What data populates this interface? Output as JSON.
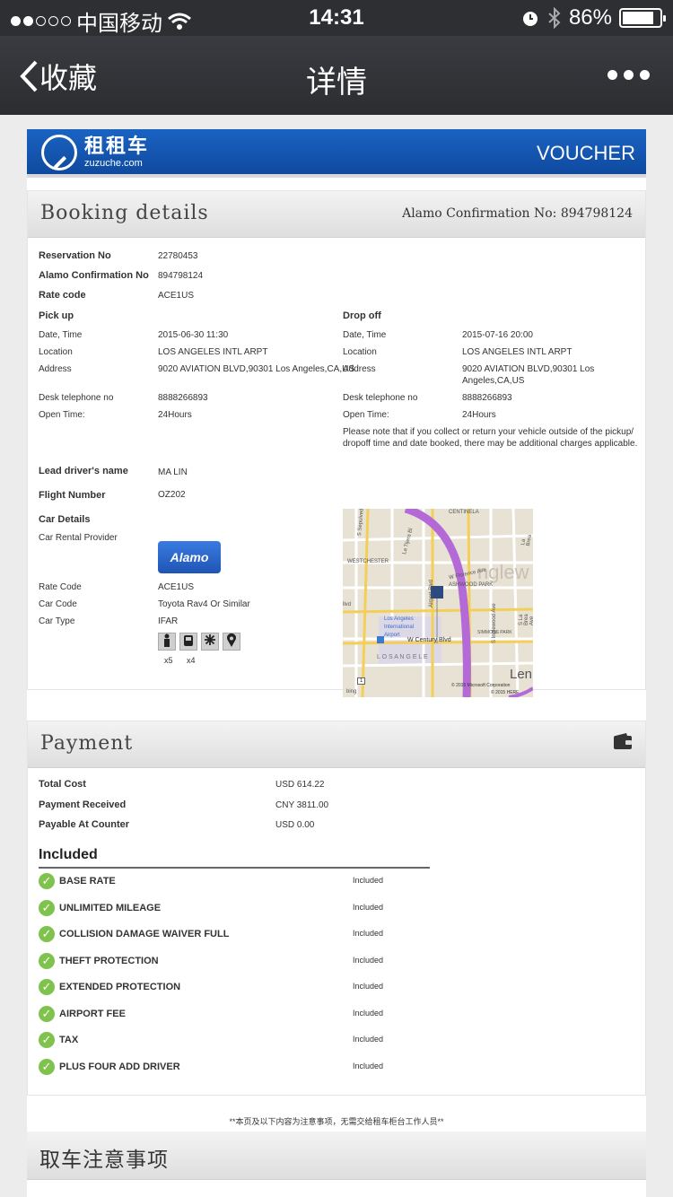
{
  "status_bar": {
    "carrier": "中国移动",
    "time": "14:31",
    "battery": "86%",
    "battery_level": 0.86
  },
  "nav": {
    "back_label": "收藏",
    "title": "详情"
  },
  "brand": {
    "name_cn": "租租车",
    "name_en": "zuzuche.com",
    "voucher": "VOUCHER"
  },
  "booking": {
    "title": "Booking details",
    "confirmation_header": "Alamo Confirmation No: 894798124",
    "reservation_label": "Reservation No",
    "reservation_value": "22780453",
    "alamo_conf_label": "Alamo Confirmation No",
    "alamo_conf_value": "894798124",
    "rate_code_label": "Rate code",
    "rate_code_value": "ACE1US",
    "pickup": {
      "heading": "Pick up",
      "date_label": "Date, Time",
      "date_value": "2015-06-30 11:30",
      "location_label": "Location",
      "location_value": "LOS ANGELES INTL ARPT",
      "address_label": "Address",
      "address_value": "9020 AVIATION BLVD,90301 Los Angeles,CA,US",
      "phone_label": "Desk telephone no",
      "phone_value": "8888266893",
      "open_label": "Open Time:",
      "open_value": "24Hours"
    },
    "dropoff": {
      "heading": "Drop off",
      "date_label": "Date, Time",
      "date_value": "2015-07-16 20:00",
      "location_label": "Location",
      "location_value": "LOS ANGELES INTL ARPT",
      "address_label": "Address",
      "address_value_1": "9020 AVIATION BLVD,90301 Los",
      "address_value_2": "Angeles,CA,US",
      "phone_label": "Desk telephone no",
      "phone_value": "8888266893",
      "open_label": "Open Time:",
      "open_value": "24Hours",
      "note_1": "Please note that if you collect or return your vehicle outside of the pickup/",
      "note_2": "dropoff time and date booked, there may be additional charges applicable."
    },
    "driver_label": "Lead driver's name",
    "driver_value": "MA LIN",
    "flight_label": "Flight Number",
    "flight_value": "OZ202",
    "car_details_heading": "Car Details",
    "provider_label": "Car Rental Provider",
    "provider_logo": "Alamo",
    "car_rate_code_label": "Rate Code",
    "car_rate_code_value": "ACE1US",
    "car_code_label": "Car Code",
    "car_code_value": "Toyota Rav4 Or Similar",
    "car_type_label": "Car Type",
    "car_type_value": "IFAR",
    "seats": "x5",
    "doors": "x4"
  },
  "map": {
    "labels": {
      "centinela": "CENTINELA",
      "westchester": "WESTCHESTER",
      "inglewood": "nglew",
      "ashwood": "ASHWOOD PARK",
      "airport_1": "Los Angeles",
      "airport_2": "International",
      "airport_3": "Airport",
      "century": "W Century Blvd",
      "los_angeles": "L O S   A N G E L E",
      "lennox": "Len",
      "sepulveda": "S Sepulveda Bl",
      "airport_blvd": "Airport Blvd",
      "la_tijera": "La Tijera Bl",
      "inglewood_ave": "S Inglewood Ave",
      "la_brea": "S La Brea Ave",
      "labrea_n": "La Brea",
      "florence": "W Florence Ave",
      "simmons": "SIMMONS PARK",
      "lvd": "llvd",
      "copyright": "© 2015 Microsoft Corporation",
      "copyright2": "© 2015 HERE",
      "bing": "bing",
      "route1": "1"
    }
  },
  "payment": {
    "title": "Payment",
    "total_label": "Total Cost",
    "total_value": "USD 614.22",
    "received_label": "Payment Received",
    "received_value": "CNY 3811.00",
    "counter_label": "Payable At Counter",
    "counter_value": "USD 0.00",
    "included_heading": "Included",
    "items": [
      {
        "name": "BASE RATE",
        "status": "Included"
      },
      {
        "name": "UNLIMITED MILEAGE",
        "status": "Included"
      },
      {
        "name": "COLLISION DAMAGE WAIVER FULL",
        "status": "Included"
      },
      {
        "name": "THEFT PROTECTION",
        "status": "Included"
      },
      {
        "name": "EXTENDED PROTECTION",
        "status": "Included"
      },
      {
        "name": "AIRPORT FEE",
        "status": "Included"
      },
      {
        "name": "TAX",
        "status": "Included"
      },
      {
        "name": "PLUS FOUR ADD DRIVER",
        "status": "Included"
      }
    ]
  },
  "footer_note": "**本页及以下内容为注意事项，无需交给租车柜台工作人员**",
  "notice_title": "取车注意事项"
}
